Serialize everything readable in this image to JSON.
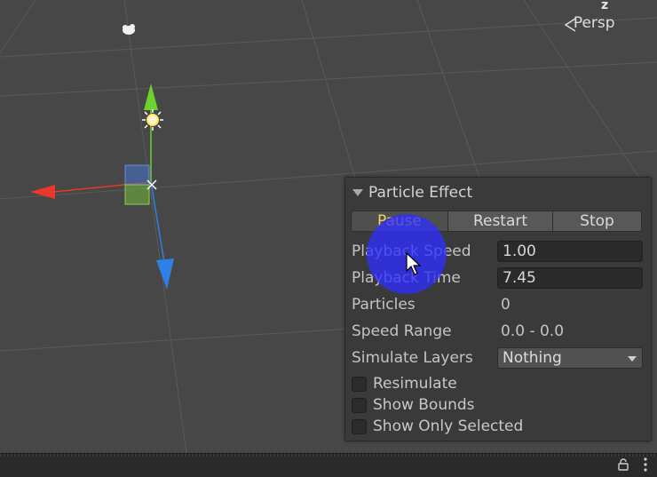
{
  "scene": {
    "view_label": "Persp",
    "axis_label": "z"
  },
  "panel": {
    "title": "Particle Effect",
    "buttons": {
      "pause": "Pause",
      "restart": "Restart",
      "stop": "Stop"
    },
    "playback_speed": {
      "label": "Playback Speed",
      "value": "1.00"
    },
    "playback_time": {
      "label": "Playback Time",
      "value": "7.45"
    },
    "particles": {
      "label": "Particles",
      "value": "0"
    },
    "speed_range": {
      "label": "Speed Range",
      "value": "0.0 - 0.0"
    },
    "simulate_layers": {
      "label": "Simulate Layers",
      "value": "Nothing"
    },
    "checkboxes": {
      "resimulate": "Resimulate",
      "show_bounds": "Show Bounds",
      "show_only_selected": "Show Only Selected"
    }
  },
  "colors": {
    "pause_text": "#f0d65c",
    "gizmo_x": "#e8392a",
    "gizmo_y": "#6ed12e",
    "gizmo_z": "#2e7fe8"
  }
}
